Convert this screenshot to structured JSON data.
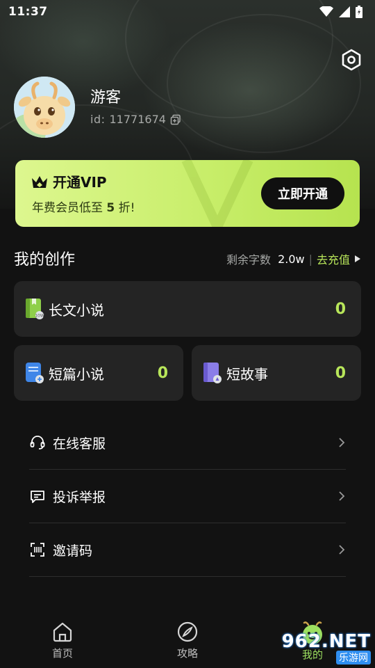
{
  "status_bar": {
    "time": "11:37",
    "icons": [
      "wifi-icon",
      "signal-icon",
      "battery-icon"
    ]
  },
  "profile": {
    "username": "游客",
    "id_label": "id:",
    "id_value": "11771674",
    "settings_icon": "settings-hex-icon",
    "copy_icon": "copy-icon"
  },
  "vip": {
    "title": "开通VIP",
    "subtitle_prefix": "年费会员低至",
    "subtitle_number": "5",
    "subtitle_suffix": "折!",
    "button_label": "立即开通",
    "crown_icon": "crown-icon"
  },
  "works": {
    "section_title": "我的创作",
    "remaining_label": "剩余字数",
    "remaining_value": "2.0w",
    "separator": "|",
    "recharge_label": "去充值",
    "cards": [
      {
        "name": "长文小说",
        "count": "0",
        "icon": "long-novel-book-icon"
      },
      {
        "name": "短篇小说",
        "count": "0",
        "icon": "short-novel-icon"
      },
      {
        "name": "短故事",
        "count": "0",
        "icon": "short-story-icon"
      }
    ]
  },
  "menu": {
    "items": [
      {
        "label": "在线客服",
        "icon": "headset-icon"
      },
      {
        "label": "投诉举报",
        "icon": "message-icon"
      },
      {
        "label": "邀请码",
        "icon": "scan-code-icon"
      }
    ]
  },
  "bottom_nav": {
    "items": [
      {
        "label": "首页",
        "icon": "home-icon"
      },
      {
        "label": "攻略",
        "icon": "compass-icon"
      },
      {
        "label": "我的",
        "icon": "mascot-icon"
      }
    ]
  },
  "watermark": {
    "big_text": "962.NET",
    "small_text": "乐游网"
  },
  "colors": {
    "accent": "#b8e65a",
    "background": "#121212",
    "card": "#242424",
    "vip_gradient_start": "#ddf78f",
    "vip_gradient_end": "#b6e34f"
  }
}
